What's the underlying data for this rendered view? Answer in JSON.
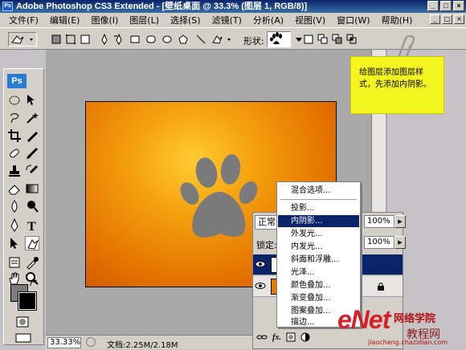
{
  "window": {
    "title": "Adobe Photoshop CS3 Extended - [壁纸桌面 @ 33.3% (图层 1, RGB/8)]",
    "app_icon": "Ps"
  },
  "menu": [
    "文件(F)",
    "编辑(E)",
    "图像(I)",
    "图层(L)",
    "选择(S)",
    "滤镜(T)",
    "分析(A)",
    "视图(V)",
    "窗口(W)",
    "帮助(H)"
  ],
  "options": {
    "shape_label": "形状:"
  },
  "toolbox": {
    "logo": "Ps"
  },
  "note": {
    "text": "给图层添加图层样式，先添加内阴影。"
  },
  "layers_panel": {
    "blend_mode": "正常",
    "lock_label": "锁定:",
    "opacity": "100%",
    "fill": "100%"
  },
  "context_menu": {
    "items": [
      "混合选项...",
      "投影...",
      "内阴影...",
      "外发光...",
      "内发光...",
      "斜面和浮雕...",
      "光泽...",
      "颜色叠加...",
      "渐变叠加...",
      "图案叠加...",
      "描边..."
    ],
    "highlighted_index": 2
  },
  "status": {
    "zoom": "33.33%",
    "doc_info": "文档:2.25M/2.18M"
  },
  "watermark": {
    "logo": "eNet",
    "line1": "网络学院",
    "line2": "教程网",
    "url": "jiaocheng.chazidian.com"
  },
  "colors": {
    "foreground": "#7c7c7c",
    "background": "#000000",
    "paw": "#7a7a7a",
    "note_bg": "#f5f520"
  }
}
